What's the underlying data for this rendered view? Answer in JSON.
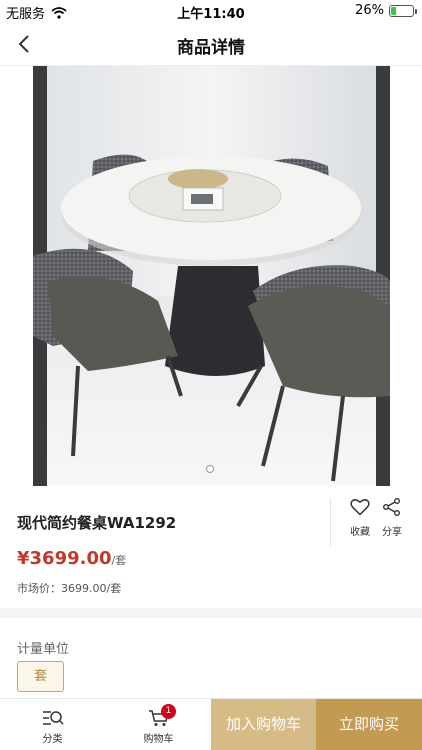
{
  "status_bar": {
    "carrier": "无服务",
    "time": "上午11:40",
    "battery_percent": "26%",
    "battery_level": 0.26,
    "battery_color": "#2ecc40"
  },
  "nav": {
    "title": "商品详情",
    "back_icon": "chevron-left-icon"
  },
  "product": {
    "name": "现代简约餐桌WA1292",
    "price": "¥3699.00",
    "price_unit": "/套",
    "market_price": "市场价：3699.00/套",
    "image_count": 1,
    "active_image_index": 0
  },
  "actions": {
    "favorite_label": "收藏",
    "favorite_icon": "heart-icon",
    "share_label": "分享",
    "share_icon": "share-icon"
  },
  "unit_section": {
    "heading": "计量单位",
    "options": [
      "套"
    ],
    "selected": "套"
  },
  "bottom_bar": {
    "category_label": "分类",
    "category_icon": "category-search-icon",
    "cart_label": "购物车",
    "cart_icon": "cart-icon",
    "cart_count": "1",
    "add_to_cart_label": "加入购物车",
    "buy_now_label": "立即购买"
  },
  "colors": {
    "price": "#c0392b",
    "accent": "#c39a52",
    "accent_light": "#d6bb86",
    "badge": "#d0021b"
  }
}
